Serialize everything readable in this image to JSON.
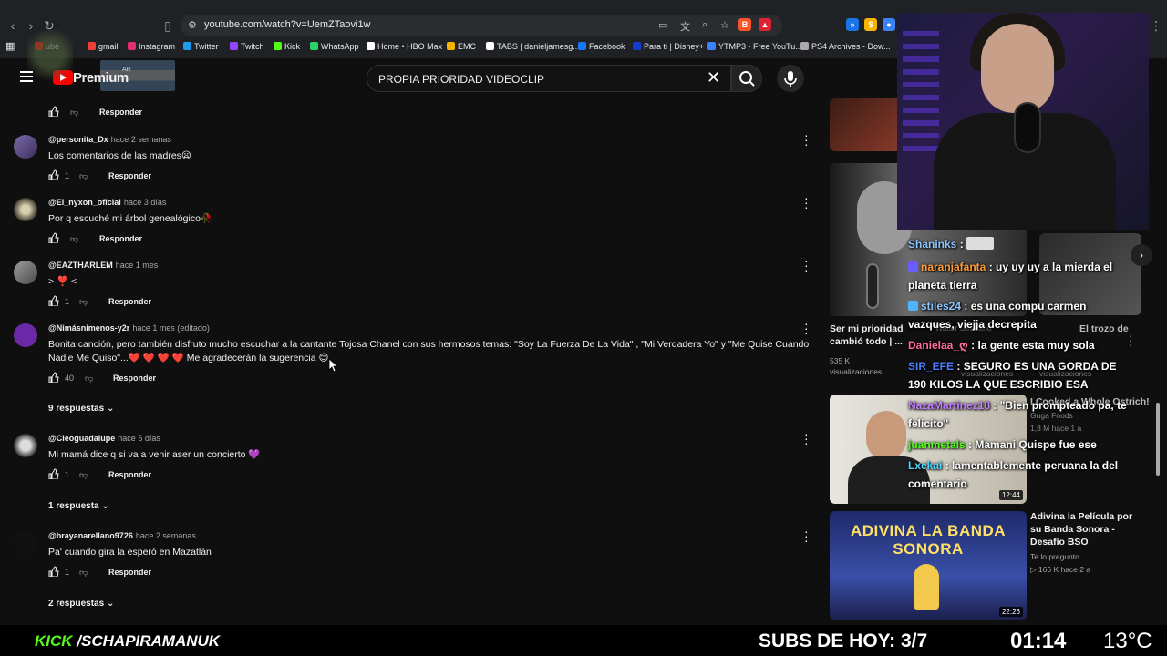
{
  "browser": {
    "url": "youtube.com/watch?v=UemZTaovi1w",
    "bookmarks": [
      {
        "label": "ube",
        "color": "#ff0000"
      },
      {
        "label": "gmail",
        "color": "#ea4335"
      },
      {
        "label": "Instagram",
        "color": "#e1306c"
      },
      {
        "label": "Twitter",
        "color": "#1d9bf0"
      },
      {
        "label": "Twitch",
        "color": "#9146ff"
      },
      {
        "label": "Kick",
        "color": "#53fc18"
      },
      {
        "label": "WhatsApp",
        "color": "#25d366"
      },
      {
        "label": "Home • HBO Max",
        "color": "#ffffff"
      },
      {
        "label": "EMC",
        "color": "#f4b400"
      },
      {
        "label": "TABS | danieljamesg...",
        "color": "#ffffff"
      },
      {
        "label": "Facebook",
        "color": "#1877f2"
      },
      {
        "label": "Para ti | Disney+",
        "color": "#113ccf"
      },
      {
        "label": "YTMP3 - Free YouTu...",
        "color": "#3b82f6"
      },
      {
        "label": "PS4 Archives - Dow...",
        "color": "#aaaaaa"
      }
    ]
  },
  "youtube": {
    "logo": "Premium",
    "country": "AR",
    "search": "PROPIA PRIORIDAD VIDEOCLIP"
  },
  "comments": [
    {
      "reply_label": "Responder"
    },
    {
      "author": "@personita_Dx",
      "time": "hace 2 semanas",
      "text": "Los comentarios de las madres😦",
      "likes": "1",
      "reply_label": "Responder"
    },
    {
      "author": "@El_nyxon_oficial",
      "time": "hace 3 días",
      "text": "Por q escuché mi árbol genealógico🥀",
      "likes": "",
      "reply_label": "Responder"
    },
    {
      "author": "@EAZTHARLEM",
      "time": "hace 1 mes",
      "text": "> ❣️ <",
      "likes": "1",
      "reply_label": "Responder"
    },
    {
      "author": "@Nimásnimenos-y2r",
      "time": "hace 1 mes (editado)",
      "text": "Bonita canción, pero también disfruto mucho escuchar a la cantante Tojosa Chanel con sus hermosos temas: \"Soy La Fuerza De La Vida\" , \"Mi Verdadera Yo\" y \"Me Quise Cuando Nadie Me Quiso\"...❤️ ❤️ ❤️ ❤️  Me agradecerán la sugerencia 😊",
      "likes": "40",
      "reply_label": "Responder",
      "replies": "9 respuestas"
    },
    {
      "author": "@Cleoguadalupe",
      "time": "hace 5 días",
      "text": "Mi mamá dice q si va a venir aser un concierto 💜",
      "likes": "1",
      "reply_label": "Responder",
      "replies": "1 respuesta"
    },
    {
      "author": "@brayanarellano9726",
      "time": "hace 2 semanas",
      "text": "Pa' cuando gira la esperó en Mazatlán",
      "likes": "1",
      "reply_label": "Responder",
      "replies": "2 respuestas"
    }
  ],
  "videos": [
    {
      "title": "Ser mi prioridad cambió todo | ...",
      "meta1": "535 K",
      "meta2": "visualizaciones",
      "overlay1": "Walter Girardino",
      "overlay2": "visualizaciones"
    },
    {
      "title": "El trozo de",
      "meta1": "visualizaciones"
    },
    {
      "title": "I Cooked a Whole Ostrich!",
      "meta1": "Guga Foods",
      "meta2": "1,3 M  hace 1 a",
      "duration": "12:44"
    },
    {
      "title": "Adivina la Película por su Banda Sonora - Desafío BSO",
      "meta1": "Te lo pregunto",
      "meta2": "▷ 166 K  hace 2 a",
      "duration": "22:26",
      "thumb_text": "ADIVINA LA BANDA SONORA"
    }
  ],
  "chat": [
    {
      "user": "Shaninks",
      "text": "",
      "color": "#8ec5ff"
    },
    {
      "user": "naranjafanta",
      "text": "uy uy uy a la mierda el planeta tierra",
      "color": "#ff9a3c"
    },
    {
      "user": "stiles24",
      "text": "es una compu carmen vazques, viejja decrepita",
      "color": "#8ec5ff"
    },
    {
      "user": "Danielaa_ღ",
      "text": "la gente esta muy sola",
      "color": "#ff6b9a"
    },
    {
      "user": "SIR_EFE",
      "text": "SEGURO ES UNA GORDA DE 190 KILOS LA QUE ESCRIBIO ESA",
      "color": "#4a7dff"
    },
    {
      "user": "NazaMartinez18",
      "text": "\"Bien prompteado pa, te felicito\"",
      "color": "#c07bff"
    },
    {
      "user": "juanmetals",
      "text": "Mamani Quispe fue ese",
      "color": "#53fc18"
    },
    {
      "user": "Lxekai",
      "text": "lamentablemente peruana la del comentario",
      "color": "#4ad7ff"
    }
  ],
  "stream": {
    "kick_logo": "KICK",
    "kick_user": "/SCHAPIRAMANUK",
    "subs": "SUBS DE HOY: 3/7",
    "time": "01:14",
    "temp": "13°C"
  }
}
